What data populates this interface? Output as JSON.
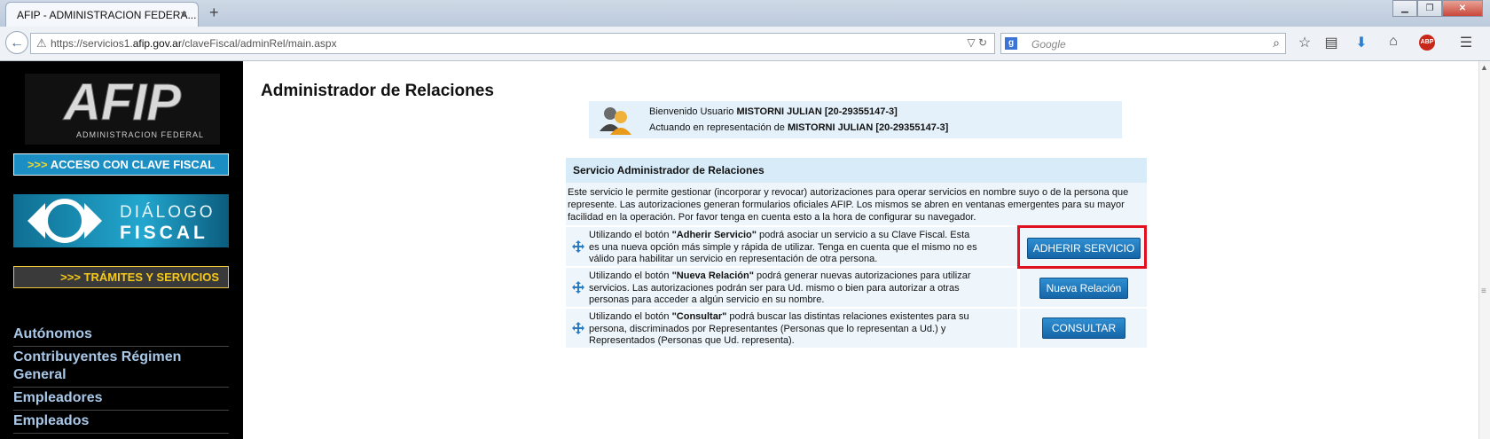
{
  "browser": {
    "tab_title": "AFIP - ADMINISTRACION FEDERA...",
    "tab_close": "×",
    "new_tab": "+",
    "url_prefix": "https://servicios1.",
    "url_domain": "afip.gov.ar",
    "url_suffix": "/claveFiscal/adminRel/main.aspx",
    "search_placeholder": "Google",
    "window_buttons": {
      "minimize": "▁",
      "maximize": "❐",
      "close": "✕"
    }
  },
  "sidebar": {
    "logo_text": "AFIP",
    "logo_subtext": "ADMINISTRACION FEDERAL",
    "clave_arrows": ">>>",
    "clave_label": "ACCESO CON CLAVE FISCAL",
    "dialogo_line1": "DIÁLOGO",
    "dialogo_line2": "FISCAL",
    "tramites_label": ">>> TRÁMITES Y SERVICIOS",
    "menu_items": [
      "Autónomos",
      "Contribuyentes Régimen General",
      "Empleadores",
      "Empleados"
    ]
  },
  "main": {
    "title": "Administrador de Relaciones",
    "welcome_prefix": "Bienvenido Usuario ",
    "welcome_user": "MISTORNI JULIAN [20-29355147-3]",
    "acting_prefix": "Actuando en representación de ",
    "acting_user": "MISTORNI JULIAN [20-29355147-3]",
    "service_header": "Servicio Administrador de Relaciones",
    "service_desc": "Este servicio le permite gestionar (incorporar y revocar) autorizaciones para operar servicios en nombre suyo o de la persona que represente. Las autorizaciones generan formularios oficiales AFIP. Los mismos se abren en ventanas emergentes para su mayor facilidad en la operación. Por favor tenga en cuenta esto a la hora de configurar su navegador.",
    "rows": [
      {
        "pre": "Utilizando el botón ",
        "bold": "\"Adherir Servicio\"",
        "post": " podrá asociar un servicio a su Clave Fiscal. Esta es una nueva opción más simple y rápida de utilizar. Tenga en cuenta que el mismo no es válido para habilitar un servicio en representación de otra persona.",
        "button": "ADHERIR SERVICIO"
      },
      {
        "pre": "Utilizando el botón ",
        "bold": "\"Nueva Relación\"",
        "post": " podrá generar nuevas autorizaciones para utilizar servicios. Las autorizaciones podrán ser para Ud. mismo o bien para autorizar a otras personas para acceder a algún servicio en su nombre.",
        "button": "Nueva Relación"
      },
      {
        "pre": "Utilizando el botón ",
        "bold": "\"Consultar\"",
        "post": " podrá buscar las distintas relaciones existentes para su persona, discriminados por Representantes (Personas que lo representan a Ud.) y Representados (Personas que Ud. representa).",
        "button": "CONSULTAR"
      }
    ]
  },
  "colors": {
    "accent_blue": "#1b8fc4",
    "button_blue": "#1565a8",
    "highlight_red": "#e0101e",
    "panel_bg": "#eef6fc",
    "tramites_yellow": "#f6c918"
  }
}
